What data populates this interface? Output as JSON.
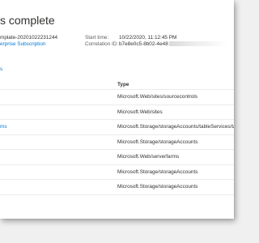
{
  "header": {
    "title": "s complete"
  },
  "deployment": {
    "name": "mplate-20201022231244",
    "subscription": "erprise Subscription",
    "start_time_label": "Start time:",
    "start_time_value": "10/22/2020, 11:12:45 PM",
    "correlation_label": "Correlation ID:",
    "correlation_value": "b7e8e0c5-8b02-4e48"
  },
  "resources": {
    "truncated_link": "s",
    "type_header": "Type",
    "rows": [
      {
        "name": "",
        "type": "Microsoft.Web/sites/sourcecontrols"
      },
      {
        "name": "",
        "type": "Microsoft.Web/sites"
      },
      {
        "name": "ms",
        "type": "Microsoft.Storage/storageAccounts/tableServices/tables"
      },
      {
        "name": "",
        "type": "Microsoft.Storage/storageAccounts"
      },
      {
        "name": "",
        "type": "Microsoft.Web/serverfarms"
      },
      {
        "name": "",
        "type": "Microsoft.Storage/storageAccounts"
      },
      {
        "name": "",
        "type": "Microsoft.Storage/storageAccounts"
      }
    ]
  },
  "colors": {
    "link": "#0078d4",
    "text": "#323130",
    "background": "#f0f0f0"
  }
}
